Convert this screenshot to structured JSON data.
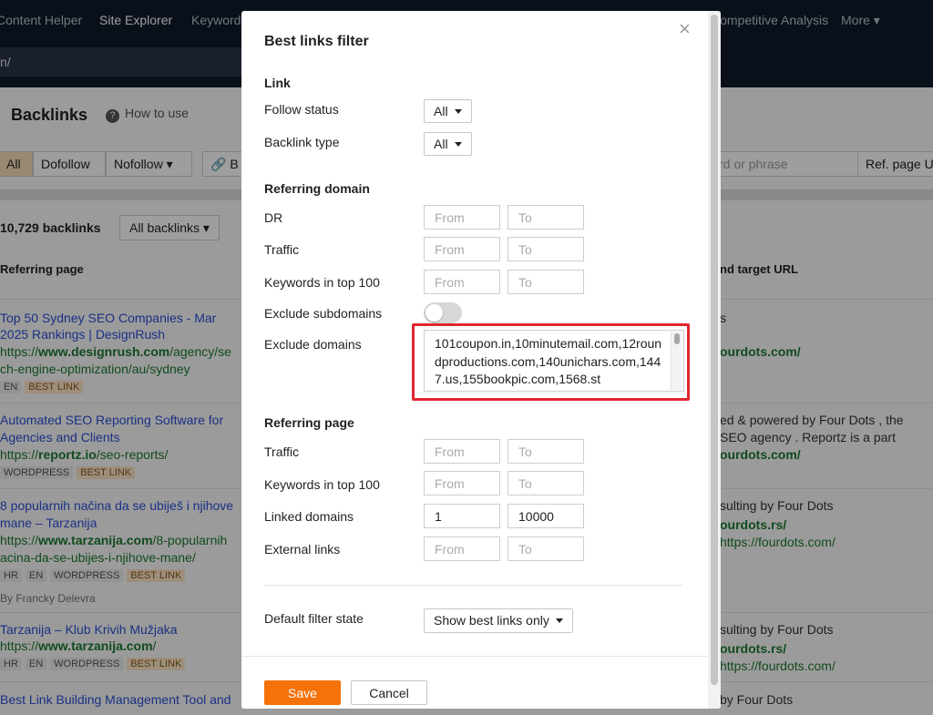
{
  "nav": {
    "items": [
      "Content Helper",
      "Site Explorer",
      "Keywords",
      "Competitive Analysis"
    ],
    "more_label": "More"
  },
  "address": {
    "value": "n/"
  },
  "background": {
    "title": "Backlinks",
    "how_to_use": "How to use",
    "filters": [
      "All",
      "Dofollow",
      "Nofollow",
      "B"
    ],
    "search_placeholder": "rd or phrase",
    "ref_page_label": "Ref. page U",
    "count": "10,729 backlinks",
    "all_backlinks": "All backlinks",
    "col_referring_page": "Referring page",
    "col_target": "nd target URL",
    "rows": [
      {
        "title1": "Top 50 Sydney SEO Companies - Mar",
        "title2": "2025 Rankings | DesignRush",
        "url1_prefix": "https://",
        "url1_domain": "www.designrush.com",
        "url1_rest": "/agency/se",
        "url2": "ch-engine-optimization/au/sydney",
        "tags": [
          "EN",
          "BEST LINK"
        ],
        "right1": "s",
        "right2": "ourdots.com/"
      },
      {
        "title1": "Automated SEO Reporting Software for",
        "title2": "Agencies and Clients",
        "url1_prefix": "https://",
        "url1_domain": "reportz.io",
        "url1_rest": "/seo-reports/",
        "tags": [
          "WORDPRESS",
          "BEST LINK"
        ],
        "right1": "ed & powered by Four Dots , the",
        "right2": "SEO agency . Reportz is a part",
        "right3": "ourdots.com/"
      },
      {
        "title1": "8 popularnih načina da se ubiješ i njihove",
        "title2": "mane – Tarzanija",
        "url1_prefix": "https://",
        "url1_domain": "www.tarzanija.com",
        "url1_rest": "/8-popularnih",
        "url2": "acina-da-se-ubijes-i-njihove-mane/",
        "tags": [
          "HR",
          "EN",
          "WORDPRESS",
          "BEST LINK"
        ],
        "author": "By Francky Delevra",
        "right1": "sulting by Four Dots",
        "right2": "ourdots.rs/",
        "right3": "https://fourdots.com/"
      },
      {
        "title1": "Tarzanija – Klub Krivih Mužjaka",
        "url1_prefix": "https://",
        "url1_domain": "www.tarzanija.com",
        "url1_rest": "/",
        "tags": [
          "HR",
          "EN",
          "WORDPRESS",
          "BEST LINK"
        ],
        "right1": "sulting by Four Dots",
        "right2": "ourdots.rs/",
        "right3": "https://fourdots.com/"
      },
      {
        "title1": "Best Link Building Management Tool and",
        "right1": "by Four Dots"
      }
    ]
  },
  "modal": {
    "title": "Best links filter",
    "close_symbol": "×",
    "link_section": "Link",
    "follow_status_label": "Follow status",
    "follow_status_value": "All",
    "backlink_type_label": "Backlink type",
    "backlink_type_value": "All",
    "referring_domain_section": "Referring domain",
    "dr_label": "DR",
    "traffic_label": "Traffic",
    "keywords_top100_label": "Keywords in top 100",
    "exclude_subdomains_label": "Exclude subdomains",
    "exclude_domains_label": "Exclude domains",
    "exclude_domains_value": "101coupon.in,10minutemail.com,12roundproductions.com,140unichars.com,1447.us,155bookpic.com,1568.st",
    "from_placeholder": "From",
    "to_placeholder": "To",
    "referring_page_section": "Referring page",
    "rp_traffic_label": "Traffic",
    "rp_keywords_label": "Keywords in top 100",
    "linked_domains_label": "Linked domains",
    "linked_domains_from": "1",
    "linked_domains_to": "10000",
    "external_links_label": "External links",
    "default_state_label": "Default filter state",
    "default_state_value": "Show best links only",
    "save_label": "Save",
    "cancel_label": "Cancel"
  }
}
